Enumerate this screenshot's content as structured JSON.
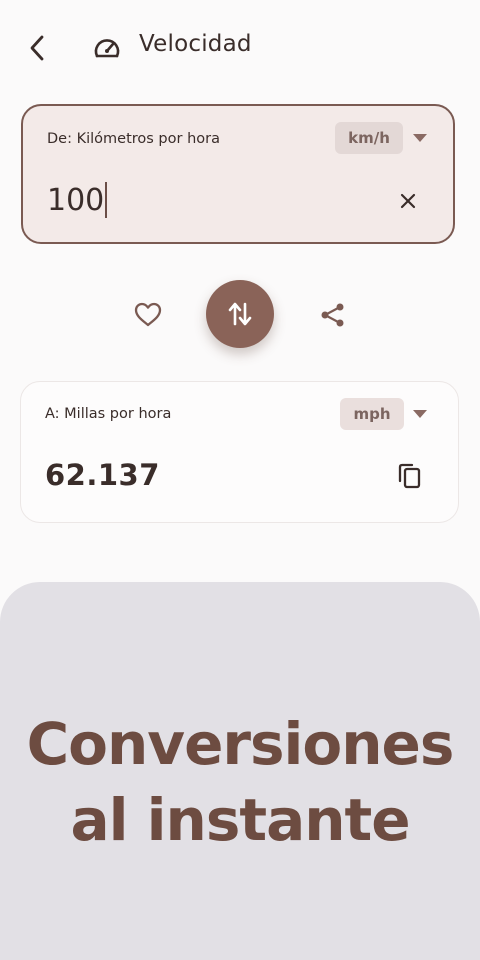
{
  "header": {
    "title": "Velocidad"
  },
  "from": {
    "label": "De: Kilómetros por hora",
    "unit": "km/h",
    "value": "100"
  },
  "to": {
    "label": "A: Millas por hora",
    "unit": "mph",
    "value": "62.137"
  },
  "promo": {
    "line1": "Conversiones",
    "line2": "al instante"
  },
  "colors": {
    "accent": "#8a6358",
    "promo_text": "#6d4c41",
    "promo_bg": "#e2e0e5"
  },
  "icons": [
    "back-arrow-icon",
    "speedometer-icon",
    "chevron-down-icon",
    "close-icon",
    "heart-icon",
    "swap-icon",
    "share-icon",
    "copy-icon"
  ]
}
